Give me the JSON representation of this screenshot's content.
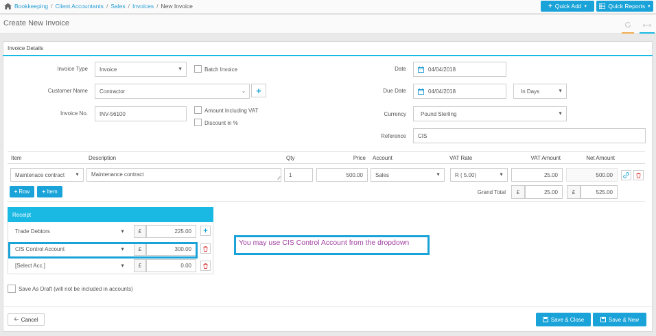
{
  "breadcrumbs": [
    "Bookkeeping",
    "Client Accountants",
    "Sales",
    "Invoices",
    "New Invoice"
  ],
  "topbar": {
    "quick_add": "Quick Add",
    "quick_reports": "Quick Reports"
  },
  "page_title": "Create New Invoice",
  "card_title": "Invoice Details",
  "form": {
    "invoice_type_label": "Invoice Type",
    "invoice_type": "Invoice",
    "batch_invoice_label": "Batch Invoice",
    "customer_name_label": "Customer Name",
    "customer_name": "Contractor",
    "invoice_no_label": "Invoice No.",
    "invoice_no": "INV-56100",
    "amount_incl_vat_label": "Amount Including VAT",
    "discount_label": "Discount in %",
    "date_label": "Date",
    "date": "04/04/2018",
    "due_date_label": "Due Date",
    "due_date": "04/04/2018",
    "due_term": "In Days",
    "currency_label": "Currency",
    "currency": "Pound Sterling",
    "reference_label": "Reference",
    "reference": "CIS"
  },
  "table": {
    "headers": {
      "item": "Item",
      "description": "Description",
      "qty": "Qty",
      "price": "Price",
      "account": "Account",
      "vat_rate": "VAT Rate",
      "vat_amount": "VAT Amount",
      "net_amount": "Net Amount"
    },
    "row": {
      "item": "Maintenace contract",
      "description": "Maintenance contract",
      "qty": "1",
      "price": "500.00",
      "account": "Sales",
      "vat_rate": "R ( 5.00)",
      "vat_amount": "25.00",
      "net_amount": "500.00"
    },
    "add_row": "Row",
    "add_item": "Item",
    "grand_total_label": "Grand Total",
    "currency_symbol": "£",
    "grand_total_vat": "25.00",
    "grand_total_net": "525.00"
  },
  "receipt": {
    "title": "Receipt",
    "currency_symbol": "£",
    "rows": [
      {
        "account": "Trade Debtors",
        "amount": "225.00"
      },
      {
        "account": "CIS Control Account",
        "amount": "300.00"
      },
      {
        "account": "[Select Acc.]",
        "amount": "0.00"
      }
    ]
  },
  "annotation": "You may use CIS Control Account from the dropdown",
  "save_draft_label": "Save As Draft (will not be included in accounts)",
  "footer": {
    "cancel": "Cancel",
    "save_close": "Save & Close",
    "save_new": "Save & New"
  },
  "colors": {
    "accent": "#1aa3d8",
    "header_line": "#1ab9e3",
    "annotation_text": "#a040a0",
    "delete": "#e05050"
  }
}
